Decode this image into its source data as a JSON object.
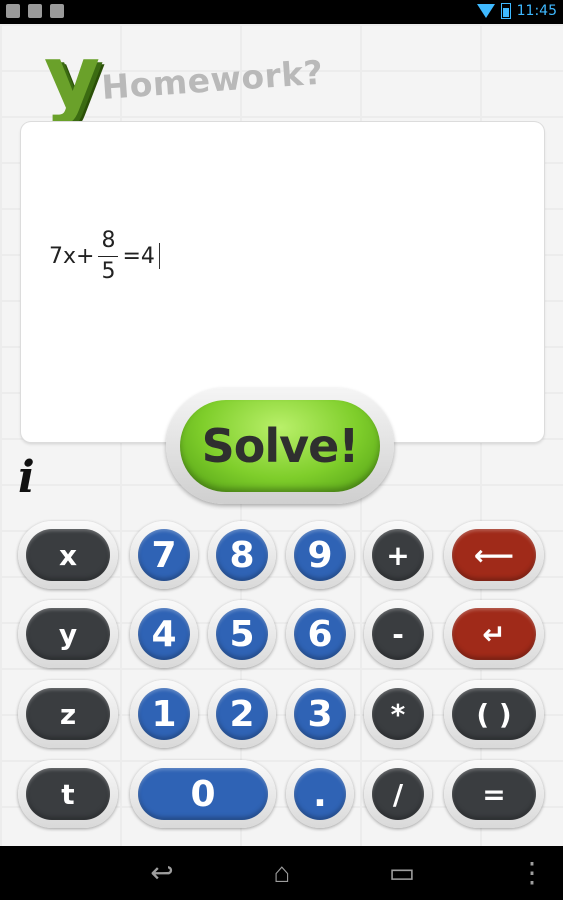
{
  "status_bar": {
    "time": "11:45",
    "icons": [
      "gallery-icon",
      "gmail-icon",
      "facebook-icon",
      "wifi-icon",
      "battery-icon"
    ]
  },
  "logo": {
    "letter": "y",
    "tagline": "Homework?"
  },
  "equation": {
    "lhs_coefficient": "7x+",
    "fraction_numerator": "8",
    "fraction_denominator": "5",
    "rhs": "=4"
  },
  "solve_button": {
    "label": "Solve!"
  },
  "info_button": {
    "label": "i"
  },
  "keypad": {
    "rows": [
      [
        "x",
        "7",
        "8",
        "9",
        "+",
        "⟵"
      ],
      [
        "y",
        "4",
        "5",
        "6",
        "-",
        "↵"
      ],
      [
        "z",
        "1",
        "2",
        "3",
        "*",
        "( )"
      ],
      [
        "t",
        "0",
        ".",
        "/",
        "="
      ]
    ],
    "labels": {
      "x": "x",
      "y": "y",
      "z": "z",
      "t": "t",
      "n7": "7",
      "n8": "8",
      "n9": "9",
      "n4": "4",
      "n5": "5",
      "n6": "6",
      "n1": "1",
      "n2": "2",
      "n3": "3",
      "n0": "0",
      "dot": ".",
      "plus": "+",
      "minus": "-",
      "times": "*",
      "divide": "/",
      "backspace": "⟵",
      "enter": "↵",
      "parens": "( )",
      "equals": "="
    }
  },
  "colors": {
    "solve_green": "#7fce2b",
    "key_dark": "#3a3d40",
    "key_blue": "#2f63b5",
    "key_red": "#a02a19",
    "logo_green": "#6aa12a"
  },
  "nav_bar": {
    "back": "↩",
    "home": "⌂",
    "recents": "▭",
    "menu": "⋮"
  }
}
